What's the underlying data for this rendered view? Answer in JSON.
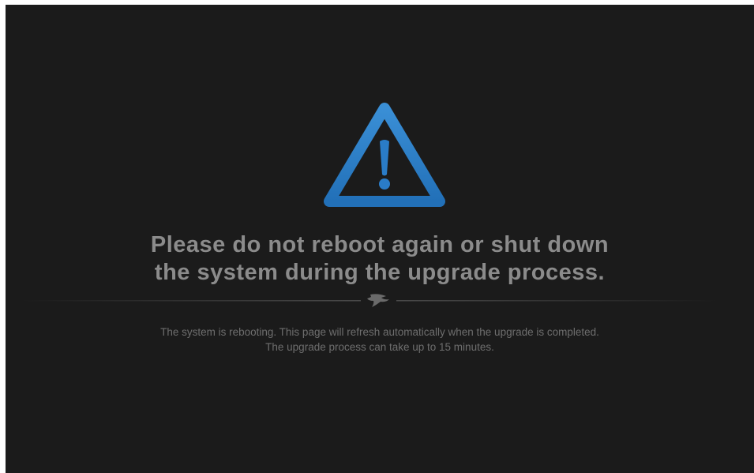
{
  "icons": {
    "warning": "warning-triangle-icon",
    "logo": "shark-logo-icon"
  },
  "colors": {
    "background": "#1b1b1b",
    "accent": "#2a7cc7",
    "headline": "#8b8b8b",
    "message": "#6e6e6e"
  },
  "headline": {
    "line1": "Please do not reboot again or shut down",
    "line2": "the system during the upgrade process."
  },
  "message": {
    "line1": "The system is rebooting. This page will refresh automatically when the upgrade is completed.",
    "line2": "The upgrade process can take up to 15 minutes."
  }
}
